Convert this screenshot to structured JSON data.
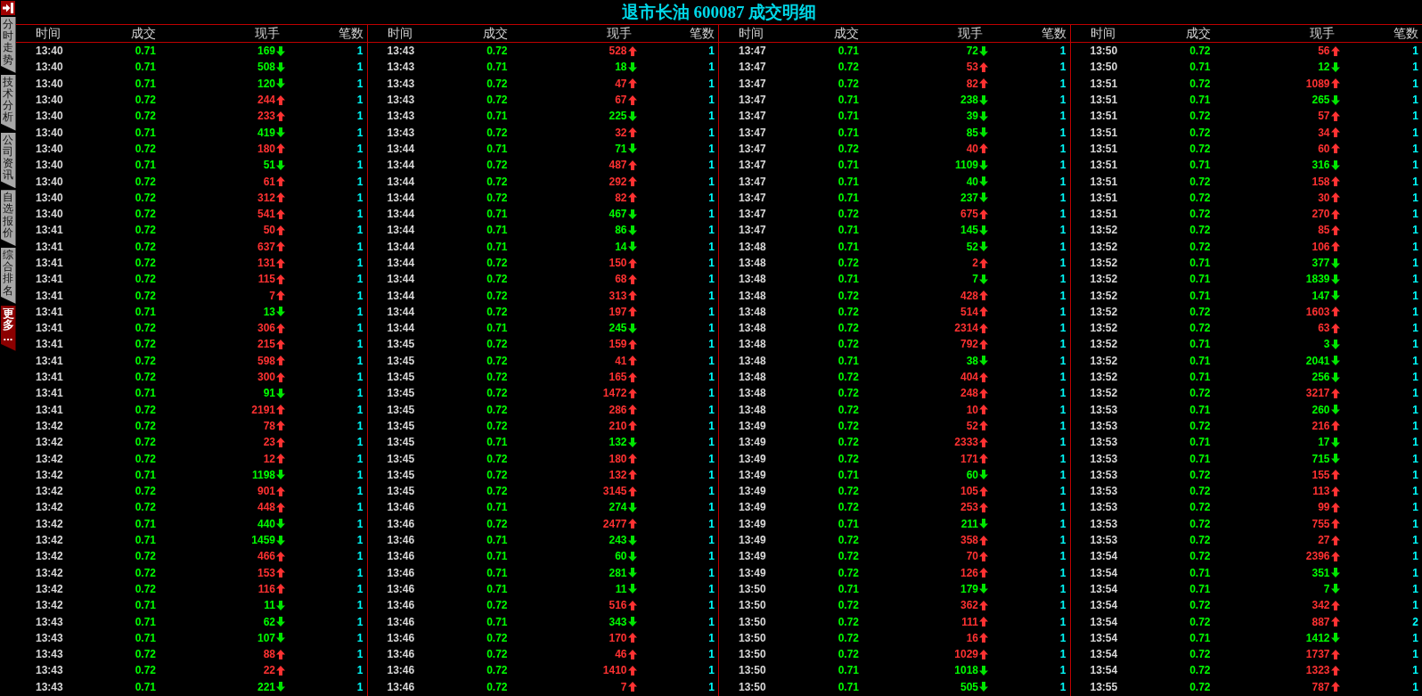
{
  "title": "退市长油 600087 成交明细",
  "sidebar": {
    "tabs": [
      {
        "label": "分时走势",
        "selected": false
      },
      {
        "label": "技术分析",
        "selected": false
      },
      {
        "label": "公司资讯",
        "selected": false
      },
      {
        "label": "自选报价",
        "selected": false
      },
      {
        "label": "综合排名",
        "selected": false
      },
      {
        "label": "更多...",
        "selected": true
      }
    ]
  },
  "blocks": [
    {
      "columns": [
        "时间",
        "成交",
        "现手",
        "笔数"
      ],
      "rows": [
        {
          "time": "13:40",
          "price": "0.71",
          "volume": "169",
          "kind": "down",
          "count": "1"
        },
        {
          "time": "13:40",
          "price": "0.71",
          "volume": "508",
          "kind": "down",
          "count": "1"
        },
        {
          "time": "13:40",
          "price": "0.71",
          "volume": "120",
          "kind": "down",
          "count": "1"
        },
        {
          "time": "13:40",
          "price": "0.72",
          "volume": "244",
          "kind": "up",
          "count": "1"
        },
        {
          "time": "13:40",
          "price": "0.72",
          "volume": "233",
          "kind": "up",
          "count": "1"
        },
        {
          "time": "13:40",
          "price": "0.71",
          "volume": "419",
          "kind": "down",
          "count": "1"
        },
        {
          "time": "13:40",
          "price": "0.72",
          "volume": "180",
          "kind": "up",
          "count": "1"
        },
        {
          "time": "13:40",
          "price": "0.71",
          "volume": "51",
          "kind": "down",
          "count": "1"
        },
        {
          "time": "13:40",
          "price": "0.72",
          "volume": "61",
          "kind": "up",
          "count": "1"
        },
        {
          "time": "13:40",
          "price": "0.72",
          "volume": "312",
          "kind": "up",
          "count": "1"
        },
        {
          "time": "13:40",
          "price": "0.72",
          "volume": "541",
          "kind": "up",
          "count": "1"
        },
        {
          "time": "13:41",
          "price": "0.72",
          "volume": "50",
          "kind": "up",
          "count": "1"
        },
        {
          "time": "13:41",
          "price": "0.72",
          "volume": "637",
          "kind": "up",
          "count": "1"
        },
        {
          "time": "13:41",
          "price": "0.72",
          "volume": "131",
          "kind": "up",
          "count": "1"
        },
        {
          "time": "13:41",
          "price": "0.72",
          "volume": "115",
          "kind": "up",
          "count": "1"
        },
        {
          "time": "13:41",
          "price": "0.72",
          "volume": "7",
          "kind": "up",
          "count": "1"
        },
        {
          "time": "13:41",
          "price": "0.71",
          "volume": "13",
          "kind": "down",
          "count": "1"
        },
        {
          "time": "13:41",
          "price": "0.72",
          "volume": "306",
          "kind": "up",
          "count": "1"
        },
        {
          "time": "13:41",
          "price": "0.72",
          "volume": "215",
          "kind": "up",
          "count": "1"
        },
        {
          "time": "13:41",
          "price": "0.72",
          "volume": "598",
          "kind": "up",
          "count": "1"
        },
        {
          "time": "13:41",
          "price": "0.72",
          "volume": "300",
          "kind": "up",
          "count": "1"
        },
        {
          "time": "13:41",
          "price": "0.71",
          "volume": "91",
          "kind": "down",
          "count": "1"
        },
        {
          "time": "13:41",
          "price": "0.72",
          "volume": "2191",
          "kind": "up",
          "count": "1"
        },
        {
          "time": "13:42",
          "price": "0.72",
          "volume": "78",
          "kind": "up",
          "count": "1"
        },
        {
          "time": "13:42",
          "price": "0.72",
          "volume": "23",
          "kind": "up",
          "count": "1"
        },
        {
          "time": "13:42",
          "price": "0.72",
          "volume": "12",
          "kind": "up",
          "count": "1"
        },
        {
          "time": "13:42",
          "price": "0.71",
          "volume": "1198",
          "kind": "down",
          "count": "1"
        },
        {
          "time": "13:42",
          "price": "0.72",
          "volume": "901",
          "kind": "up",
          "count": "1"
        },
        {
          "time": "13:42",
          "price": "0.72",
          "volume": "448",
          "kind": "up",
          "count": "1"
        },
        {
          "time": "13:42",
          "price": "0.71",
          "volume": "440",
          "kind": "down",
          "count": "1"
        },
        {
          "time": "13:42",
          "price": "0.71",
          "volume": "1459",
          "kind": "down",
          "count": "1"
        },
        {
          "time": "13:42",
          "price": "0.72",
          "volume": "466",
          "kind": "up",
          "count": "1"
        },
        {
          "time": "13:42",
          "price": "0.72",
          "volume": "153",
          "kind": "up",
          "count": "1"
        },
        {
          "time": "13:42",
          "price": "0.72",
          "volume": "116",
          "kind": "up",
          "count": "1"
        },
        {
          "time": "13:42",
          "price": "0.71",
          "volume": "11",
          "kind": "down",
          "count": "1"
        },
        {
          "time": "13:43",
          "price": "0.71",
          "volume": "62",
          "kind": "down",
          "count": "1"
        },
        {
          "time": "13:43",
          "price": "0.71",
          "volume": "107",
          "kind": "down",
          "count": "1"
        },
        {
          "time": "13:43",
          "price": "0.72",
          "volume": "88",
          "kind": "up",
          "count": "1"
        },
        {
          "time": "13:43",
          "price": "0.72",
          "volume": "22",
          "kind": "up",
          "count": "1"
        },
        {
          "time": "13:43",
          "price": "0.71",
          "volume": "221",
          "kind": "down",
          "count": "1"
        }
      ]
    },
    {
      "columns": [
        "时间",
        "成交",
        "现手",
        "笔数"
      ],
      "rows": [
        {
          "time": "13:43",
          "price": "0.72",
          "volume": "528",
          "kind": "up",
          "count": "1"
        },
        {
          "time": "13:43",
          "price": "0.71",
          "volume": "18",
          "kind": "down",
          "count": "1"
        },
        {
          "time": "13:43",
          "price": "0.72",
          "volume": "47",
          "kind": "up",
          "count": "1"
        },
        {
          "time": "13:43",
          "price": "0.72",
          "volume": "67",
          "kind": "up",
          "count": "1"
        },
        {
          "time": "13:43",
          "price": "0.71",
          "volume": "225",
          "kind": "down",
          "count": "1"
        },
        {
          "time": "13:43",
          "price": "0.72",
          "volume": "32",
          "kind": "up",
          "count": "1"
        },
        {
          "time": "13:44",
          "price": "0.71",
          "volume": "71",
          "kind": "down",
          "count": "1"
        },
        {
          "time": "13:44",
          "price": "0.72",
          "volume": "487",
          "kind": "up",
          "count": "1"
        },
        {
          "time": "13:44",
          "price": "0.72",
          "volume": "292",
          "kind": "up",
          "count": "1"
        },
        {
          "time": "13:44",
          "price": "0.72",
          "volume": "82",
          "kind": "up",
          "count": "1"
        },
        {
          "time": "13:44",
          "price": "0.71",
          "volume": "467",
          "kind": "down",
          "count": "1"
        },
        {
          "time": "13:44",
          "price": "0.71",
          "volume": "86",
          "kind": "down",
          "count": "1"
        },
        {
          "time": "13:44",
          "price": "0.71",
          "volume": "14",
          "kind": "down",
          "count": "1"
        },
        {
          "time": "13:44",
          "price": "0.72",
          "volume": "150",
          "kind": "up",
          "count": "1"
        },
        {
          "time": "13:44",
          "price": "0.72",
          "volume": "68",
          "kind": "up",
          "count": "1"
        },
        {
          "time": "13:44",
          "price": "0.72",
          "volume": "313",
          "kind": "up",
          "count": "1"
        },
        {
          "time": "13:44",
          "price": "0.72",
          "volume": "197",
          "kind": "up",
          "count": "1"
        },
        {
          "time": "13:44",
          "price": "0.71",
          "volume": "245",
          "kind": "down",
          "count": "1"
        },
        {
          "time": "13:45",
          "price": "0.72",
          "volume": "159",
          "kind": "up",
          "count": "1"
        },
        {
          "time": "13:45",
          "price": "0.72",
          "volume": "41",
          "kind": "up",
          "count": "1"
        },
        {
          "time": "13:45",
          "price": "0.72",
          "volume": "165",
          "kind": "up",
          "count": "1"
        },
        {
          "time": "13:45",
          "price": "0.72",
          "volume": "1472",
          "kind": "up",
          "count": "1"
        },
        {
          "time": "13:45",
          "price": "0.72",
          "volume": "286",
          "kind": "up",
          "count": "1"
        },
        {
          "time": "13:45",
          "price": "0.72",
          "volume": "210",
          "kind": "up",
          "count": "1"
        },
        {
          "time": "13:45",
          "price": "0.71",
          "volume": "132",
          "kind": "down",
          "count": "1"
        },
        {
          "time": "13:45",
          "price": "0.72",
          "volume": "180",
          "kind": "up",
          "count": "1"
        },
        {
          "time": "13:45",
          "price": "0.72",
          "volume": "132",
          "kind": "up",
          "count": "1"
        },
        {
          "time": "13:45",
          "price": "0.72",
          "volume": "3145",
          "kind": "up",
          "count": "1"
        },
        {
          "time": "13:46",
          "price": "0.71",
          "volume": "274",
          "kind": "down",
          "count": "1"
        },
        {
          "time": "13:46",
          "price": "0.72",
          "volume": "2477",
          "kind": "up",
          "count": "1"
        },
        {
          "time": "13:46",
          "price": "0.71",
          "volume": "243",
          "kind": "down",
          "count": "1"
        },
        {
          "time": "13:46",
          "price": "0.71",
          "volume": "60",
          "kind": "down",
          "count": "1"
        },
        {
          "time": "13:46",
          "price": "0.71",
          "volume": "281",
          "kind": "down",
          "count": "1"
        },
        {
          "time": "13:46",
          "price": "0.71",
          "volume": "11",
          "kind": "down",
          "count": "1"
        },
        {
          "time": "13:46",
          "price": "0.72",
          "volume": "516",
          "kind": "up",
          "count": "1"
        },
        {
          "time": "13:46",
          "price": "0.71",
          "volume": "343",
          "kind": "down",
          "count": "1"
        },
        {
          "time": "13:46",
          "price": "0.72",
          "volume": "170",
          "kind": "up",
          "count": "1"
        },
        {
          "time": "13:46",
          "price": "0.72",
          "volume": "46",
          "kind": "up",
          "count": "1"
        },
        {
          "time": "13:46",
          "price": "0.72",
          "volume": "1410",
          "kind": "up",
          "count": "1"
        },
        {
          "time": "13:46",
          "price": "0.72",
          "volume": "7",
          "kind": "up",
          "count": "1"
        }
      ]
    },
    {
      "columns": [
        "时间",
        "成交",
        "现手",
        "笔数"
      ],
      "rows": [
        {
          "time": "13:47",
          "price": "0.71",
          "volume": "72",
          "kind": "down",
          "count": "1"
        },
        {
          "time": "13:47",
          "price": "0.72",
          "volume": "53",
          "kind": "up",
          "count": "1"
        },
        {
          "time": "13:47",
          "price": "0.72",
          "volume": "82",
          "kind": "up",
          "count": "1"
        },
        {
          "time": "13:47",
          "price": "0.71",
          "volume": "238",
          "kind": "down",
          "count": "1"
        },
        {
          "time": "13:47",
          "price": "0.71",
          "volume": "39",
          "kind": "down",
          "count": "1"
        },
        {
          "time": "13:47",
          "price": "0.71",
          "volume": "85",
          "kind": "down",
          "count": "1"
        },
        {
          "time": "13:47",
          "price": "0.72",
          "volume": "40",
          "kind": "up",
          "count": "1"
        },
        {
          "time": "13:47",
          "price": "0.71",
          "volume": "1109",
          "kind": "down",
          "count": "1"
        },
        {
          "time": "13:47",
          "price": "0.71",
          "volume": "40",
          "kind": "down",
          "count": "1"
        },
        {
          "time": "13:47",
          "price": "0.71",
          "volume": "237",
          "kind": "down",
          "count": "1"
        },
        {
          "time": "13:47",
          "price": "0.72",
          "volume": "675",
          "kind": "up",
          "count": "1"
        },
        {
          "time": "13:47",
          "price": "0.71",
          "volume": "145",
          "kind": "down",
          "count": "1"
        },
        {
          "time": "13:48",
          "price": "0.71",
          "volume": "52",
          "kind": "down",
          "count": "1"
        },
        {
          "time": "13:48",
          "price": "0.72",
          "volume": "2",
          "kind": "up",
          "count": "1"
        },
        {
          "time": "13:48",
          "price": "0.71",
          "volume": "7",
          "kind": "down",
          "count": "1"
        },
        {
          "time": "13:48",
          "price": "0.72",
          "volume": "428",
          "kind": "up",
          "count": "1"
        },
        {
          "time": "13:48",
          "price": "0.72",
          "volume": "514",
          "kind": "up",
          "count": "1"
        },
        {
          "time": "13:48",
          "price": "0.72",
          "volume": "2314",
          "kind": "up",
          "count": "1"
        },
        {
          "time": "13:48",
          "price": "0.72",
          "volume": "792",
          "kind": "up",
          "count": "1"
        },
        {
          "time": "13:48",
          "price": "0.71",
          "volume": "38",
          "kind": "down",
          "count": "1"
        },
        {
          "time": "13:48",
          "price": "0.72",
          "volume": "404",
          "kind": "up",
          "count": "1"
        },
        {
          "time": "13:48",
          "price": "0.72",
          "volume": "248",
          "kind": "up",
          "count": "1"
        },
        {
          "time": "13:48",
          "price": "0.72",
          "volume": "10",
          "kind": "up",
          "count": "1"
        },
        {
          "time": "13:49",
          "price": "0.72",
          "volume": "52",
          "kind": "up",
          "count": "1"
        },
        {
          "time": "13:49",
          "price": "0.72",
          "volume": "2333",
          "kind": "up",
          "count": "1"
        },
        {
          "time": "13:49",
          "price": "0.72",
          "volume": "171",
          "kind": "up",
          "count": "1"
        },
        {
          "time": "13:49",
          "price": "0.71",
          "volume": "60",
          "kind": "down",
          "count": "1"
        },
        {
          "time": "13:49",
          "price": "0.72",
          "volume": "105",
          "kind": "up",
          "count": "1"
        },
        {
          "time": "13:49",
          "price": "0.72",
          "volume": "253",
          "kind": "up",
          "count": "1"
        },
        {
          "time": "13:49",
          "price": "0.71",
          "volume": "211",
          "kind": "down",
          "count": "1"
        },
        {
          "time": "13:49",
          "price": "0.72",
          "volume": "358",
          "kind": "up",
          "count": "1"
        },
        {
          "time": "13:49",
          "price": "0.72",
          "volume": "70",
          "kind": "up",
          "count": "1"
        },
        {
          "time": "13:49",
          "price": "0.72",
          "volume": "126",
          "kind": "up",
          "count": "1"
        },
        {
          "time": "13:50",
          "price": "0.71",
          "volume": "179",
          "kind": "down",
          "count": "1"
        },
        {
          "time": "13:50",
          "price": "0.72",
          "volume": "362",
          "kind": "up",
          "count": "1"
        },
        {
          "time": "13:50",
          "price": "0.72",
          "volume": "111",
          "kind": "up",
          "count": "1"
        },
        {
          "time": "13:50",
          "price": "0.72",
          "volume": "16",
          "kind": "up",
          "count": "1"
        },
        {
          "time": "13:50",
          "price": "0.72",
          "volume": "1029",
          "kind": "up",
          "count": "1"
        },
        {
          "time": "13:50",
          "price": "0.71",
          "volume": "1018",
          "kind": "down",
          "count": "1"
        },
        {
          "time": "13:50",
          "price": "0.71",
          "volume": "505",
          "kind": "down",
          "count": "1"
        }
      ]
    },
    {
      "columns": [
        "时间",
        "成交",
        "现手",
        "笔数"
      ],
      "rows": [
        {
          "time": "13:50",
          "price": "0.72",
          "volume": "56",
          "kind": "up",
          "count": "1"
        },
        {
          "time": "13:50",
          "price": "0.71",
          "volume": "12",
          "kind": "down",
          "count": "1"
        },
        {
          "time": "13:51",
          "price": "0.72",
          "volume": "1089",
          "kind": "up",
          "count": "1"
        },
        {
          "time": "13:51",
          "price": "0.71",
          "volume": "265",
          "kind": "down",
          "count": "1"
        },
        {
          "time": "13:51",
          "price": "0.72",
          "volume": "57",
          "kind": "up",
          "count": "1"
        },
        {
          "time": "13:51",
          "price": "0.72",
          "volume": "34",
          "kind": "up",
          "count": "1"
        },
        {
          "time": "13:51",
          "price": "0.72",
          "volume": "60",
          "kind": "up",
          "count": "1"
        },
        {
          "time": "13:51",
          "price": "0.71",
          "volume": "316",
          "kind": "down",
          "count": "1"
        },
        {
          "time": "13:51",
          "price": "0.72",
          "volume": "158",
          "kind": "up",
          "count": "1"
        },
        {
          "time": "13:51",
          "price": "0.72",
          "volume": "30",
          "kind": "up",
          "count": "1"
        },
        {
          "time": "13:51",
          "price": "0.72",
          "volume": "270",
          "kind": "up",
          "count": "1"
        },
        {
          "time": "13:52",
          "price": "0.72",
          "volume": "85",
          "kind": "up",
          "count": "1"
        },
        {
          "time": "13:52",
          "price": "0.72",
          "volume": "106",
          "kind": "up",
          "count": "1"
        },
        {
          "time": "13:52",
          "price": "0.71",
          "volume": "377",
          "kind": "down",
          "count": "1"
        },
        {
          "time": "13:52",
          "price": "0.71",
          "volume": "1839",
          "kind": "down",
          "count": "1"
        },
        {
          "time": "13:52",
          "price": "0.71",
          "volume": "147",
          "kind": "down",
          "count": "1"
        },
        {
          "time": "13:52",
          "price": "0.72",
          "volume": "1603",
          "kind": "up",
          "count": "1"
        },
        {
          "time": "13:52",
          "price": "0.72",
          "volume": "63",
          "kind": "up",
          "count": "1"
        },
        {
          "time": "13:52",
          "price": "0.71",
          "volume": "3",
          "kind": "down",
          "count": "1"
        },
        {
          "time": "13:52",
          "price": "0.71",
          "volume": "2041",
          "kind": "down",
          "count": "1"
        },
        {
          "time": "13:52",
          "price": "0.71",
          "volume": "256",
          "kind": "down",
          "count": "1"
        },
        {
          "time": "13:52",
          "price": "0.72",
          "volume": "3217",
          "kind": "up",
          "count": "1"
        },
        {
          "time": "13:53",
          "price": "0.71",
          "volume": "260",
          "kind": "down",
          "count": "1"
        },
        {
          "time": "13:53",
          "price": "0.72",
          "volume": "216",
          "kind": "up",
          "count": "1"
        },
        {
          "time": "13:53",
          "price": "0.71",
          "volume": "17",
          "kind": "down",
          "count": "1"
        },
        {
          "time": "13:53",
          "price": "0.71",
          "volume": "715",
          "kind": "down",
          "count": "1"
        },
        {
          "time": "13:53",
          "price": "0.72",
          "volume": "155",
          "kind": "up",
          "count": "1"
        },
        {
          "time": "13:53",
          "price": "0.72",
          "volume": "113",
          "kind": "up",
          "count": "1"
        },
        {
          "time": "13:53",
          "price": "0.72",
          "volume": "99",
          "kind": "up",
          "count": "1"
        },
        {
          "time": "13:53",
          "price": "0.72",
          "volume": "755",
          "kind": "up",
          "count": "1"
        },
        {
          "time": "13:53",
          "price": "0.72",
          "volume": "27",
          "kind": "up",
          "count": "1"
        },
        {
          "time": "13:54",
          "price": "0.72",
          "volume": "2396",
          "kind": "up",
          "count": "1"
        },
        {
          "time": "13:54",
          "price": "0.71",
          "volume": "351",
          "kind": "down",
          "count": "1"
        },
        {
          "time": "13:54",
          "price": "0.71",
          "volume": "7",
          "kind": "down",
          "count": "1"
        },
        {
          "time": "13:54",
          "price": "0.72",
          "volume": "342",
          "kind": "up",
          "count": "1"
        },
        {
          "time": "13:54",
          "price": "0.72",
          "volume": "887",
          "kind": "up",
          "count": "2"
        },
        {
          "time": "13:54",
          "price": "0.71",
          "volume": "1412",
          "kind": "down",
          "count": "1"
        },
        {
          "time": "13:54",
          "price": "0.72",
          "volume": "1737",
          "kind": "up",
          "count": "1"
        },
        {
          "time": "13:54",
          "price": "0.72",
          "volume": "1323",
          "kind": "up",
          "count": "1"
        },
        {
          "time": "13:55",
          "price": "0.72",
          "volume": "787",
          "kind": "up",
          "count": "1"
        }
      ]
    }
  ]
}
